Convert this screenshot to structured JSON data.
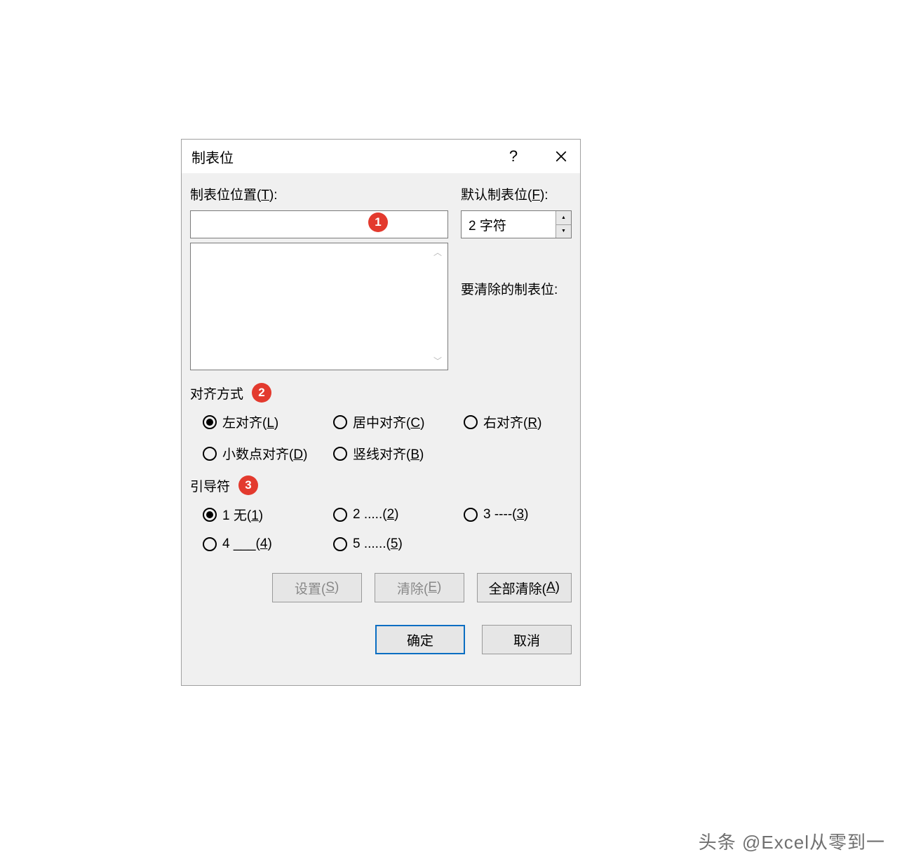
{
  "dialog": {
    "title": "制表位",
    "position_label": "制表位位置(T):",
    "default_label": "默认制表位(F):",
    "default_value": "2 字符",
    "clear_label": "要清除的制表位:",
    "align_section": "对齐方式",
    "leader_section": "引导符",
    "align_options": {
      "left": "左对齐(L)",
      "center": "居中对齐(C)",
      "right": "右对齐(R)",
      "decimal": "小数点对齐(D)",
      "bar": "竖线对齐(B)"
    },
    "leader_options": {
      "l1": "1 无(1)",
      "l2": "2 .....(2)",
      "l3": "3 ----(3)",
      "l4": "4 ___(4)",
      "l5": "5 ......(5)"
    },
    "buttons": {
      "set": "设置(S)",
      "clear": "清除(E)",
      "clear_all": "全部清除(A)",
      "ok": "确定",
      "cancel": "取消"
    },
    "badges": {
      "b1": "1",
      "b2": "2",
      "b3": "3"
    }
  },
  "watermark": "头条 @Excel从零到一"
}
